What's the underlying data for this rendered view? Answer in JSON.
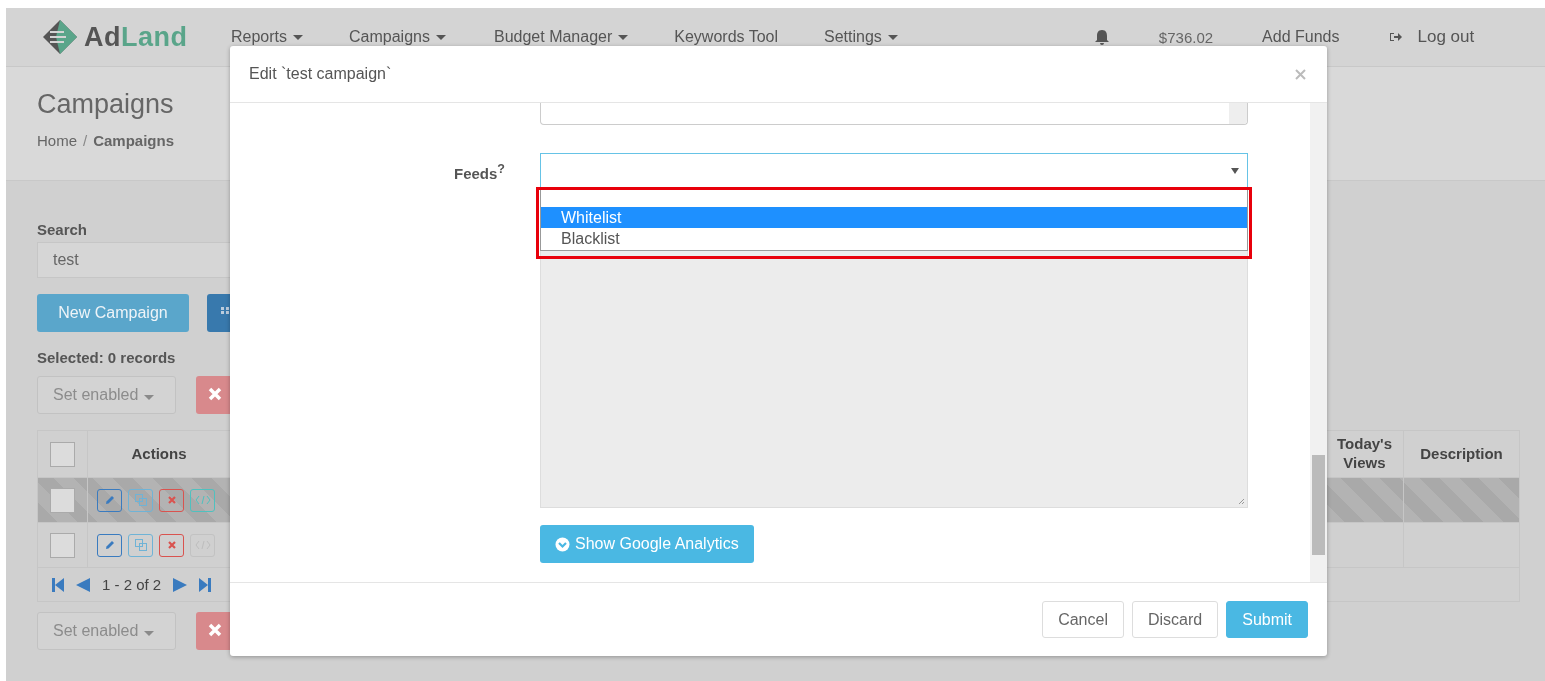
{
  "navbar": {
    "logo": {
      "prefix": "Ad",
      "suffix": "Land"
    },
    "items": [
      {
        "label": "Reports",
        "dropdown": true
      },
      {
        "label": "Campaigns",
        "dropdown": true
      },
      {
        "label": "Budget Manager",
        "dropdown": true
      },
      {
        "label": "Keywords Tool",
        "dropdown": false
      },
      {
        "label": "Settings",
        "dropdown": true
      }
    ],
    "balance": "$736.02",
    "add_funds": "Add Funds",
    "logout": "Log out"
  },
  "header": {
    "title": "Campaigns",
    "breadcrumb": [
      "Home",
      "Campaigns"
    ],
    "separator": "/"
  },
  "search": {
    "label": "Search",
    "value": "test"
  },
  "new_campaign": "New Campaign",
  "selected_info": "Selected: 0 records",
  "bulk_action": {
    "label": "Set enabled",
    "disabled": true
  },
  "table": {
    "select_all_checked": false,
    "columns": [
      "Actions",
      "Today's Views",
      "Description"
    ],
    "rows": [
      {
        "checked": false,
        "highlighted": true,
        "code_enabled": true
      },
      {
        "checked": false,
        "highlighted": false,
        "code_enabled": false
      }
    ],
    "pagination": "1 - 2 of 2"
  },
  "bulk_action_bottom": {
    "label": "Set enabled",
    "disabled": true
  },
  "modal": {
    "title": "Edit `test campaign`",
    "feeds": {
      "label": "Feeds$^{?}$",
      "options": [
        {
          "selected": false
        },
        {
          "label": "Whitelist",
          "selected": true
        },
        {
          "label": "Blacklist",
          "selected": false
        }
      ]
    },
    "textarea": {
      "disabled": true
    },
    "analytics_button": "Show Google Analytics",
    "buttons": [
      {
        "label": "Cancel",
        "kind": "default"
      },
      {
        "label": "Discard",
        "kind": "default"
      },
      {
        "label": "Submit",
        "kind": "primary"
      }
    ]
  }
}
